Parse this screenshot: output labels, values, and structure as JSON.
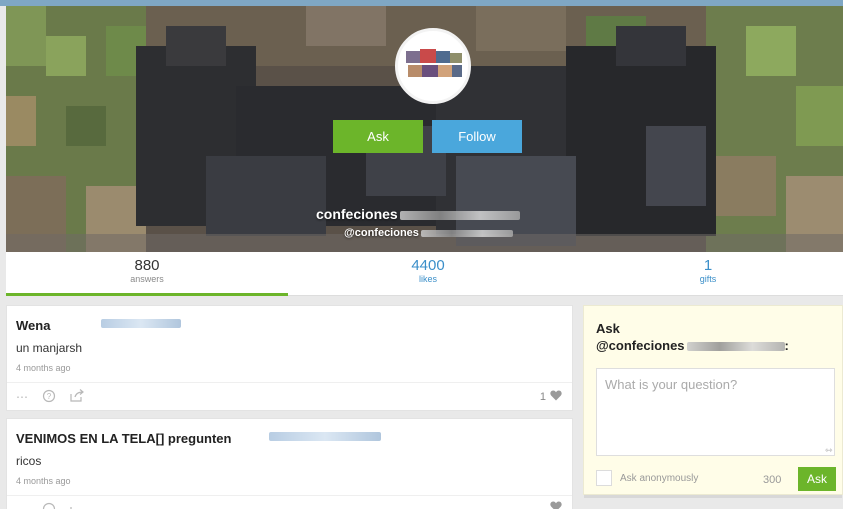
{
  "profile": {
    "display_name": "confeciones",
    "handle": "@confeciones"
  },
  "actions": {
    "ask_label": "Ask",
    "follow_label": "Follow"
  },
  "stats": [
    {
      "value": "880",
      "label": "answers"
    },
    {
      "value": "4400",
      "label": "likes"
    },
    {
      "value": "1",
      "label": "gifts"
    }
  ],
  "feed": [
    {
      "question": "Wena",
      "answer": "un manjarsh",
      "time": "4 months ago",
      "likes": "1"
    },
    {
      "question": "VENIMOS EN LA TELA[] pregunten",
      "answer": "ricos",
      "time": "4 months ago",
      "likes": ""
    }
  ],
  "ask_box": {
    "title": "Ask",
    "target_handle": "@confeciones",
    "target_suffix": ":",
    "placeholder": "What is your question?",
    "anonymous_label": "Ask anonymously",
    "char_limit": "300",
    "submit_label": "Ask"
  },
  "icons": {
    "more": "more-icon",
    "question": "question-icon",
    "share": "share-icon",
    "heart": "heart-icon"
  },
  "colors": {
    "accent_green": "#6cb52a",
    "accent_blue": "#4aa7dc",
    "link_blue": "#3b8fc9"
  }
}
